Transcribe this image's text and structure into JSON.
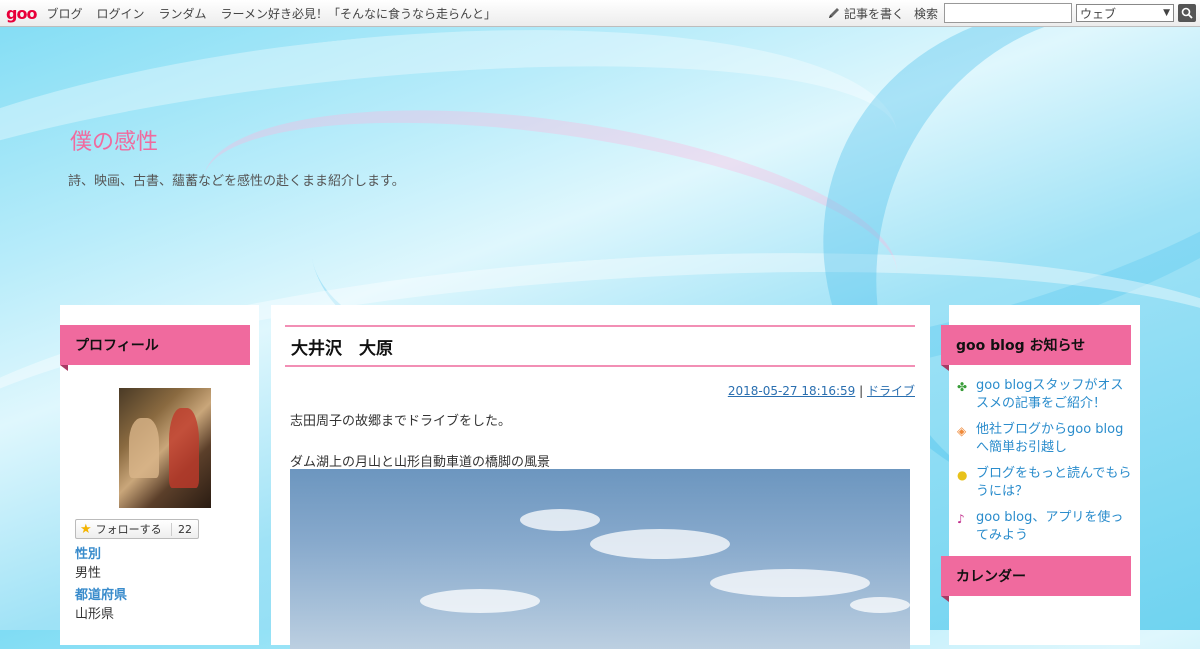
{
  "topbar": {
    "logo": "goo",
    "links": [
      "ブログ",
      "ログイン",
      "ランダム",
      "ラーメン好き必見！「そんなに食うなら走らんと」"
    ],
    "write_label": "記事を書く",
    "search_label": "検索",
    "search_value": "",
    "search_scope": "ウェブ"
  },
  "header": {
    "title": "僕の感性",
    "description": "詩、映画、古書、蘊蓄などを感性の赴くまま紹介します。"
  },
  "profile": {
    "heading": "プロフィール",
    "follow_label": "フォローする",
    "follow_count": "22",
    "fields": [
      {
        "label": "性別",
        "value": "男性"
      },
      {
        "label": "都道府県",
        "value": "山形県"
      }
    ]
  },
  "article": {
    "title": "大井沢　大原",
    "datetime": "2018-05-27 18:16:59",
    "separator": "|",
    "category": "ドライブ",
    "paragraphs": [
      "志田周子の故郷までドライブをした。",
      "ダム湖上の月山と山形自動車道の橋脚の風景"
    ]
  },
  "notices": {
    "heading": "goo blog お知らせ",
    "items": [
      {
        "icon": "clover-icon",
        "label": "goo blogスタッフがオススメの記事をご紹介！",
        "color": "#3a9d3a"
      },
      {
        "icon": "diamond-icon",
        "label": "他社ブログからgoo blogへ簡単お引越し",
        "color": "#f08a3a"
      },
      {
        "icon": "bulb-icon",
        "label": "ブログをもっと読んでもらうには？",
        "color": "#e8c21a"
      },
      {
        "icon": "music-note-icon",
        "label": "goo blog、アプリを使ってみよう",
        "color": "#c02a8a"
      }
    ]
  },
  "calendar": {
    "heading": "カレンダー"
  }
}
